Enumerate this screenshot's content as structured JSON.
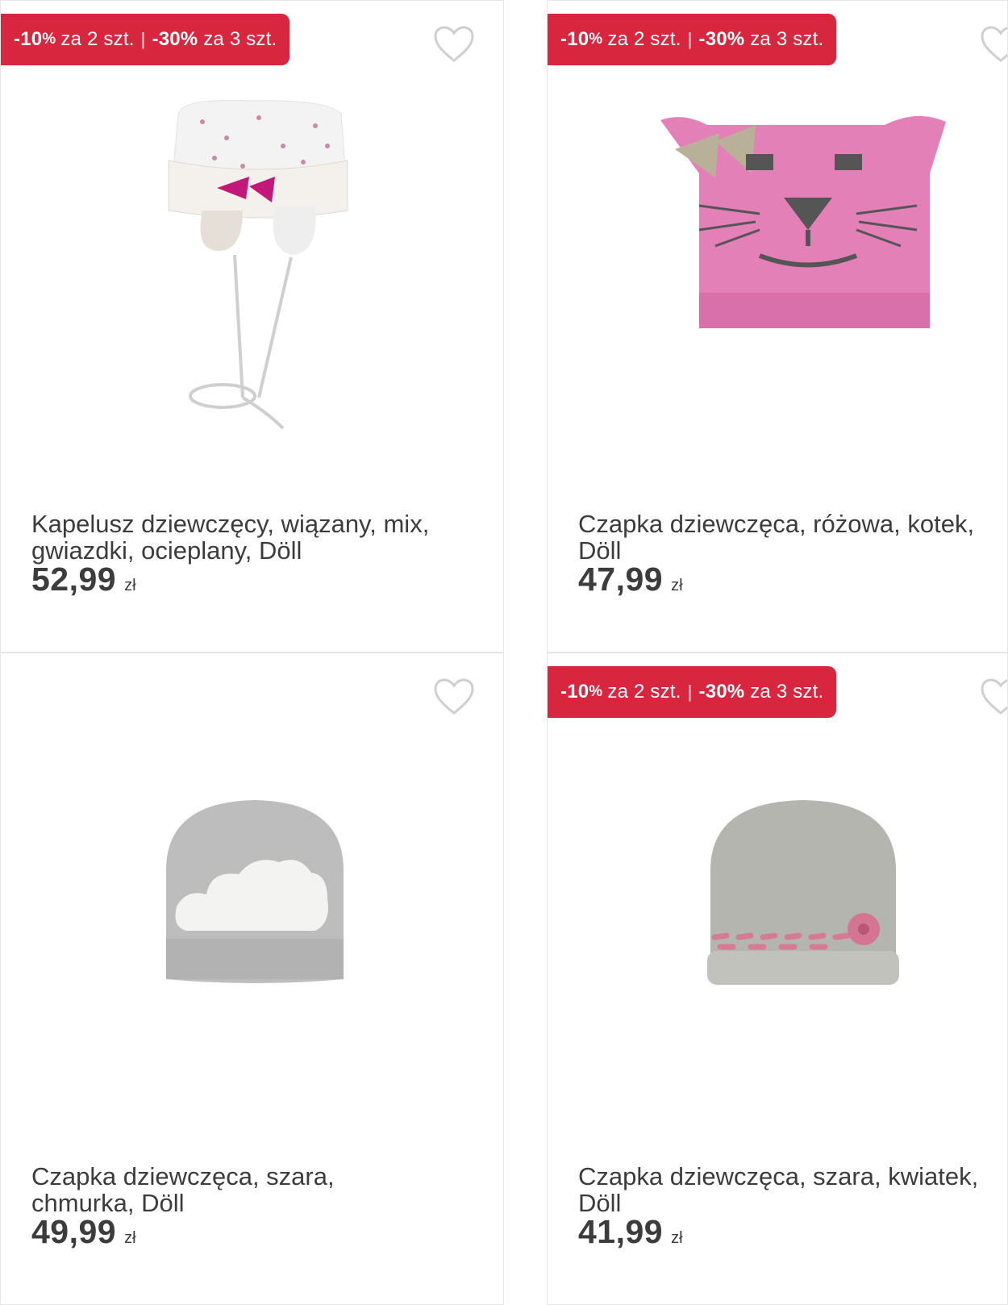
{
  "products": [
    {
      "badge": {
        "a_val": "-10",
        "a_pct": "%",
        "a_text": "za 2 szt.",
        "sep": "|",
        "b_val": "-30%",
        "b_text": "za 3 szt."
      },
      "title": "Kapelusz dziewczęcy, wiązany, mix,\ngwiazdki, ocieplany, Döll",
      "price": "52,99",
      "currency": "zł",
      "image": "white-starry-hat-with-ties"
    },
    {
      "badge": {
        "a_val": "-10",
        "a_pct": "%",
        "a_text": "za 2 szt.",
        "sep": "|",
        "b_val": "-30%",
        "b_text": "za 3 szt."
      },
      "title": "Czapka dziewczęca, różowa, kotek,\nDöll",
      "price": "47,99",
      "currency": "zł",
      "image": "pink-cat-knit-hat"
    },
    {
      "title": "Czapka dziewczęca, szara,\nchmurka, Döll",
      "price": "49,99",
      "currency": "zł",
      "image": "grey-cloud-beanie"
    },
    {
      "badge": {
        "a_val": "-10",
        "a_pct": "%",
        "a_text": "za 2 szt.",
        "sep": "|",
        "b_val": "-30%",
        "b_text": "za 3 szt."
      },
      "title": "Czapka dziewczęca, szara, kwiatek,\nDöll",
      "price": "41,99",
      "currency": "zł",
      "image": "grey-flower-knit-hat"
    }
  ],
  "icons": {
    "favorite": "heart-outline-icon"
  },
  "colors": {
    "badge": "#d9263f",
    "text": "#3c3c3c",
    "border": "#e6e6e6"
  }
}
